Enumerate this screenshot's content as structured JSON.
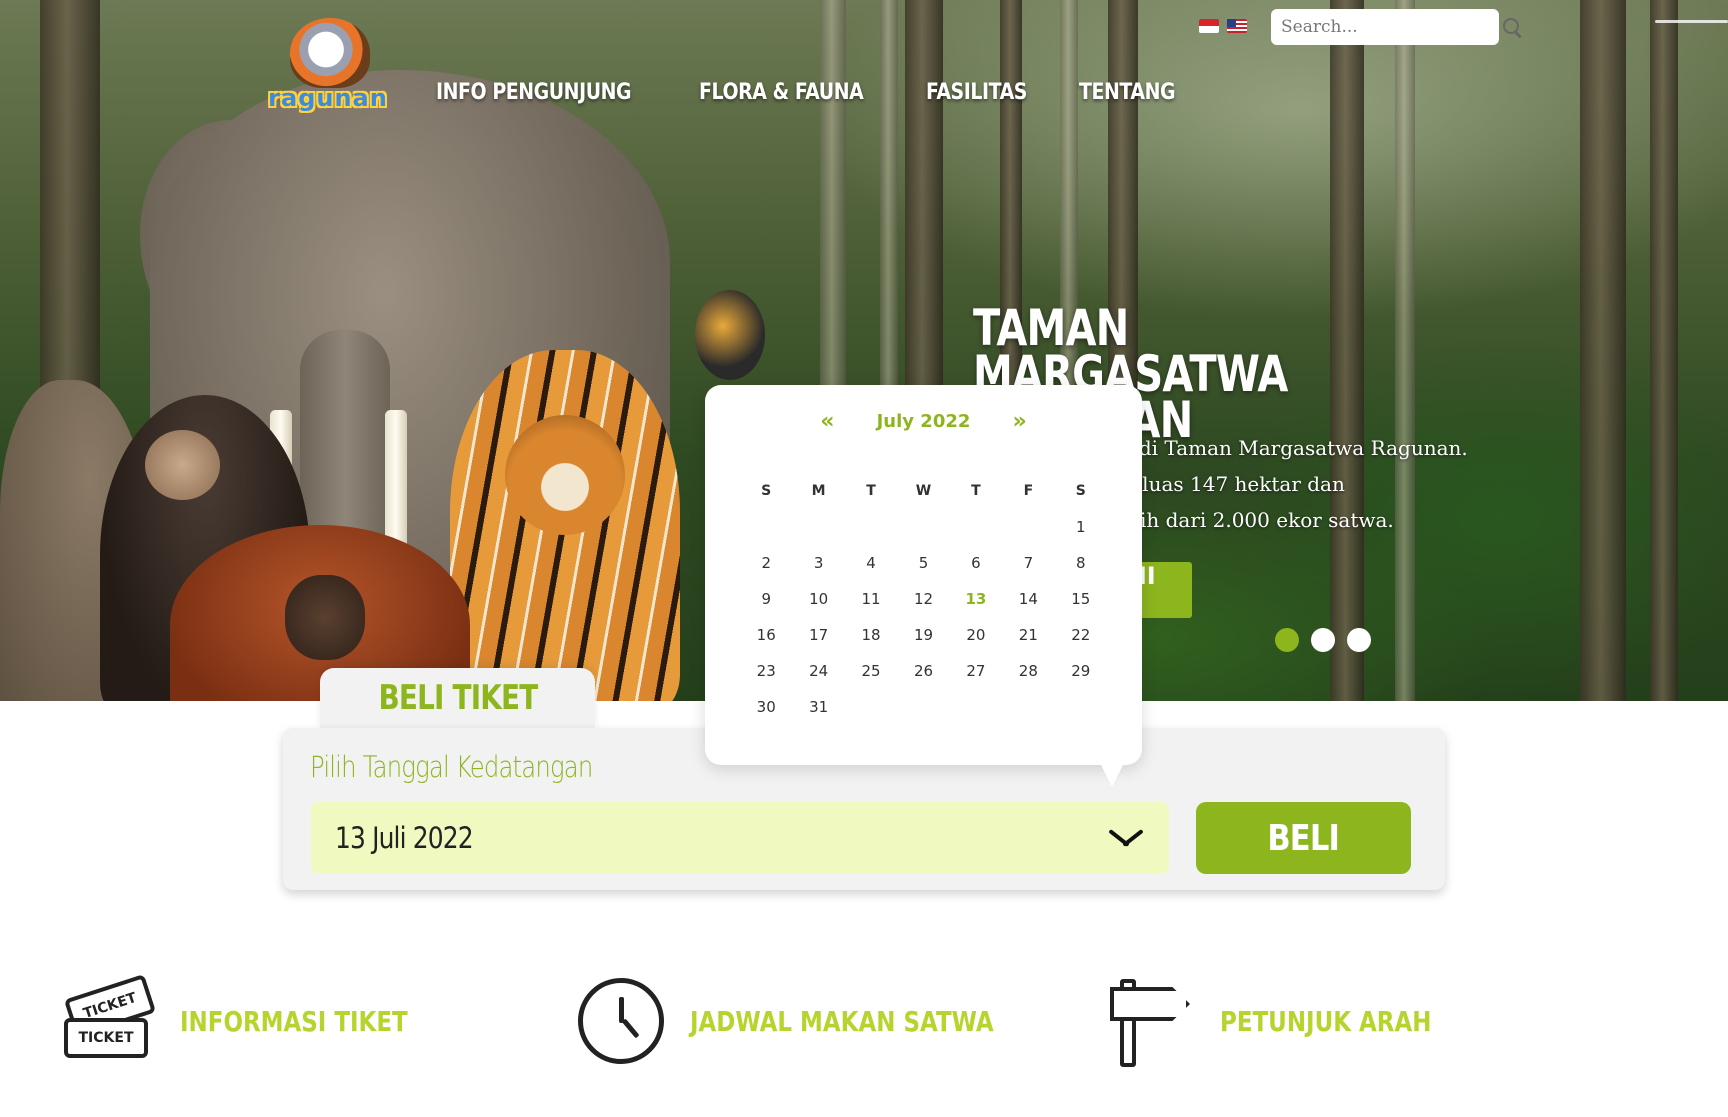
{
  "header": {
    "logo_text": "ragunan",
    "nav": [
      {
        "label": "INFO PENGUNJUNG"
      },
      {
        "label": "FLORA & FAUNA"
      },
      {
        "label": "FASILITAS"
      },
      {
        "label": "TENTANG"
      }
    ],
    "languages": [
      "id-flag-icon",
      "us-flag-icon"
    ],
    "search": {
      "placeholder": "Search...",
      "value": ""
    }
  },
  "hero": {
    "title": "TAMAN MARGASATWA RAGUNAN",
    "description": "Selamat datang di Taman Margasatwa Ragunan. Dengan lahan seluas 147 hektar dan berpenghuni lebih dari 2.000 ekor satwa.",
    "cta_label": "JELAJAHI SATWA",
    "slides": 3,
    "active_slide": 1
  },
  "ticket": {
    "tab_label": "BELI TIKET",
    "date_label": "Pilih Tanggal Kedatangan",
    "date_value": "13 Juli 2022",
    "buy_label": "BELI"
  },
  "calendar": {
    "prev": "«",
    "next": "»",
    "month_title": "July 2022",
    "weekdays": [
      "S",
      "M",
      "T",
      "W",
      "T",
      "F",
      "S"
    ],
    "leading_blanks": 6,
    "days_in_month": 31,
    "selected_day": 13
  },
  "features": [
    {
      "label": "INFORMASI TIKET",
      "icon": "ticket-icon",
      "ticket_text_top": "TICKET",
      "ticket_text_bottom": "TICKET"
    },
    {
      "label": "JADWAL MAKAN SATWA",
      "icon": "clock-icon"
    },
    {
      "label": "PETUNJUK ARAH",
      "icon": "signpost-icon"
    }
  ],
  "colors": {
    "accent": "#8db51e",
    "feature_text": "#b5d52e",
    "date_field_bg": "#f0f9c0",
    "box_bg": "#f2f2f2"
  }
}
